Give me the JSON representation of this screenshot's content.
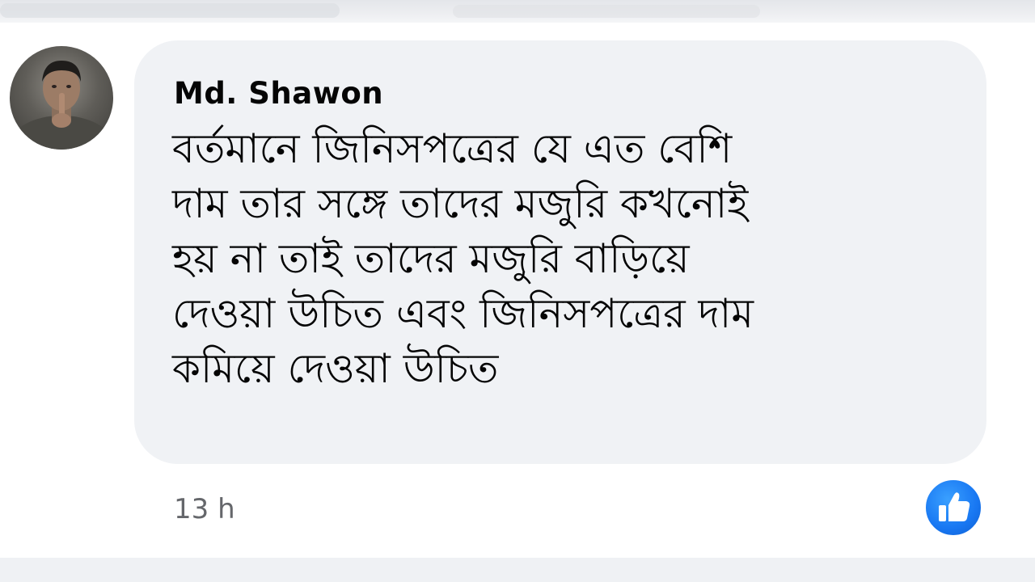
{
  "comment": {
    "author": "Md. Shawon",
    "text": "বর্তমানে জিনিসপত্রের যে এত বেশি\nদাম তার সঙ্গে তাদের মজুরি কখনোই\nহয় না তাই তাদের মজুরি বাড়িয়ে\nদেওয়া উচিত এবং জিনিসপত্রের দাম\nকমিয়ে দেওয়া উচিত",
    "timestamp": "13 h",
    "reaction_icon": "like-icon"
  },
  "colors": {
    "bubble": "#f0f2f5",
    "text": "#050505",
    "secondary_text": "#65676b",
    "like_blue": "#1877f2"
  }
}
